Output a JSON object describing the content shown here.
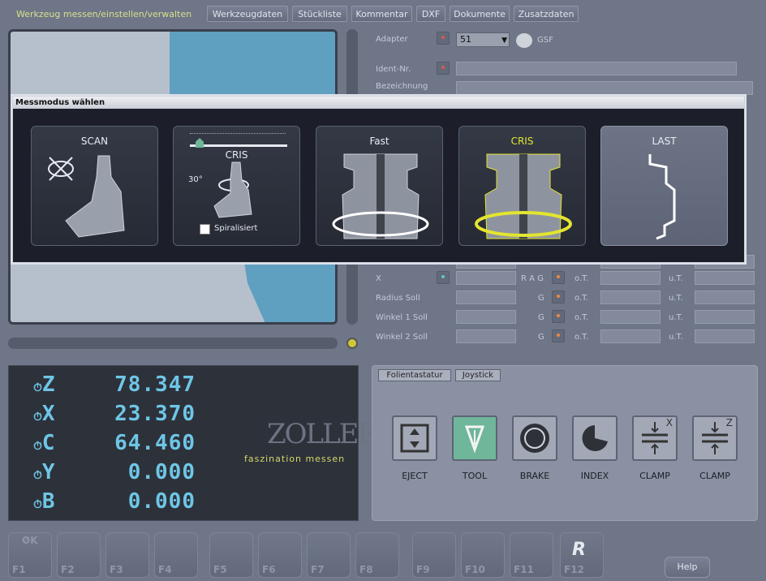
{
  "tabs": [
    {
      "label": "Werkzeug messen/einstellen/verwalten"
    },
    {
      "label": "Werkzeugdaten"
    },
    {
      "label": "Stückliste"
    },
    {
      "label": "Kommentar"
    },
    {
      "label": "DXF"
    },
    {
      "label": "Dokumente"
    },
    {
      "label": "Zusatzdaten"
    }
  ],
  "form": {
    "adapter_label": "Adapter",
    "adapter_value": "51",
    "gsf": "GSF",
    "ident_label": "Ident-Nr.",
    "bezeichnung_label": "Bezeichnung",
    "rows": [
      {
        "label": "X",
        "flags": "R A G",
        "tol1": "o.T.",
        "tol2": "u.T."
      },
      {
        "label": "Radius Soll",
        "flags": "G",
        "tol1": "o.T.",
        "tol2": "u.T."
      },
      {
        "label": "Winkel 1 Soll",
        "flags": "G",
        "tol1": "o.T.",
        "tol2": "u.T."
      },
      {
        "label": "Winkel 2 Soll",
        "flags": "G",
        "tol1": "o.T.",
        "tol2": "u.T."
      }
    ]
  },
  "modal": {
    "title": "Messmodus wählen",
    "cards": [
      {
        "label": "SCAN"
      },
      {
        "label": "CRIS",
        "angle": "30°",
        "checkbox": "Spiralisiert"
      },
      {
        "label": "Fast"
      },
      {
        "label": "CRIS"
      },
      {
        "label": "LAST"
      }
    ]
  },
  "dro": {
    "axes": [
      {
        "axis": "Z",
        "value": "78.347"
      },
      {
        "axis": "X",
        "value": "23.370"
      },
      {
        "axis": "C",
        "value": "64.460"
      },
      {
        "axis": "Y",
        "value": "0.000"
      },
      {
        "axis": "B",
        "value": "0.000"
      }
    ],
    "brand": "ZOLLER",
    "slogan": "faszination messen"
  },
  "control": {
    "tabs": [
      {
        "label": "Folientastatur"
      },
      {
        "label": "Joystick"
      }
    ],
    "buttons": [
      {
        "label": "EJECT"
      },
      {
        "label": "TOOL"
      },
      {
        "label": "BRAKE"
      },
      {
        "label": "INDEX"
      },
      {
        "label": "CLAMP",
        "axis": "X"
      },
      {
        "label": "CLAMP",
        "axis": "Z"
      }
    ]
  },
  "fkeys": [
    "F1",
    "F2",
    "F3",
    "F4",
    "F5",
    "F6",
    "F7",
    "F8",
    "F9",
    "F10",
    "F11",
    "F12"
  ],
  "ok_label": "OK",
  "help_label": "Help",
  "colors": {
    "accent_green": "#d8e08a",
    "dro_digits": "#6ec6e6",
    "cris_yellow": "#e3e52f",
    "tool_active": "#6fb69a"
  }
}
